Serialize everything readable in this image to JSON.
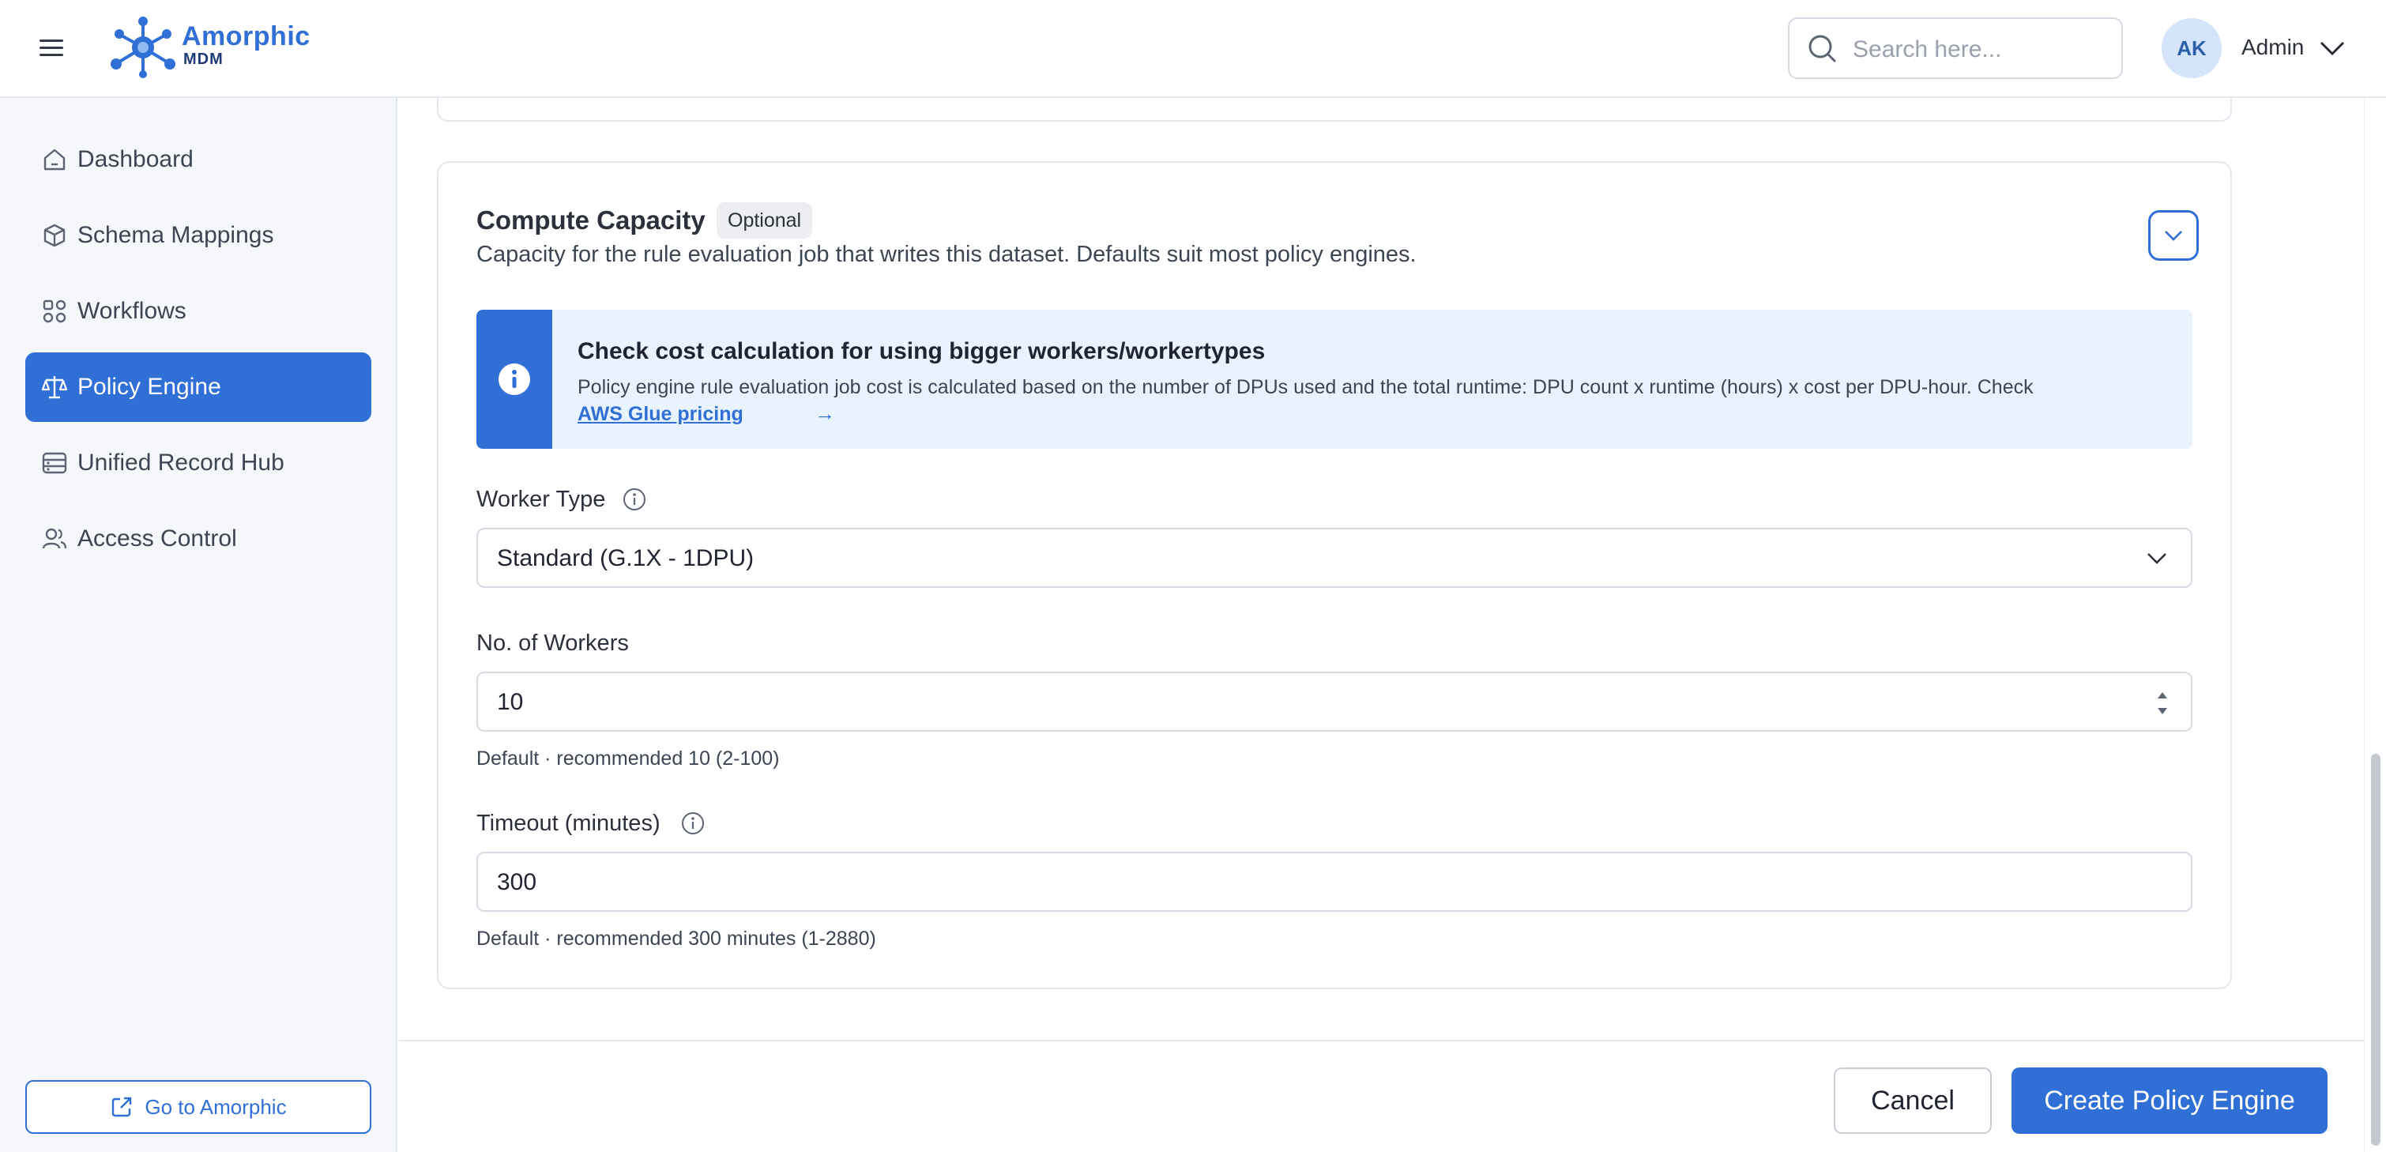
{
  "app": {
    "logo_title": "Amorphic",
    "logo_subtitle": "MDM",
    "accent_color": "#2f6fd6"
  },
  "header": {
    "search_placeholder": "Search here...",
    "avatar_initials": "AK",
    "user_name": "Admin"
  },
  "sidebar": {
    "items": [
      {
        "label": "Dashboard",
        "icon": "home-icon",
        "active": false
      },
      {
        "label": "Schema Mappings",
        "icon": "cube-icon",
        "active": false
      },
      {
        "label": "Workflows",
        "icon": "workflow-icon",
        "active": false
      },
      {
        "label": "Policy Engine",
        "icon": "scale-icon",
        "active": true
      },
      {
        "label": "Unified Record Hub",
        "icon": "database-icon",
        "active": false
      },
      {
        "label": "Access Control",
        "icon": "users-icon",
        "active": false
      }
    ],
    "goto_label": "Go to Amorphic"
  },
  "section": {
    "title": "Compute Capacity",
    "badge": "Optional",
    "description": "Capacity for the rule evaluation job that writes this dataset. Defaults suit most policy engines."
  },
  "info_banner": {
    "title": "Check cost calculation for using bigger workers/workertypes",
    "body": "Policy engine rule evaluation job cost is calculated based on the number of DPUs used and the total runtime: DPU count x runtime (hours) x cost per DPU-hour. Check",
    "link_label": "AWS Glue pricing",
    "link_arrow": "→"
  },
  "fields": {
    "worker_type": {
      "label": "Worker Type",
      "value": "Standard (G.1X - 1DPU)"
    },
    "num_workers": {
      "label": "No. of Workers",
      "value": "10",
      "help": "Default · recommended 10 (2-100)"
    },
    "timeout": {
      "label": "Timeout (minutes)",
      "value": "300",
      "help": "Default · recommended 300 minutes (1-2880)"
    }
  },
  "footer": {
    "cancel_label": "Cancel",
    "create_label": "Create Policy Engine"
  }
}
